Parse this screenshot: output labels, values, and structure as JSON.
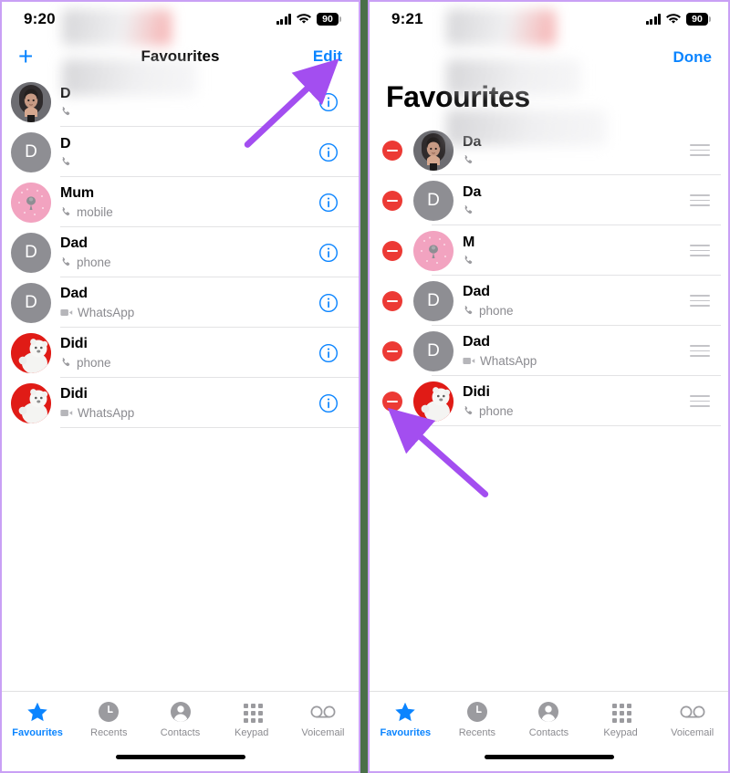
{
  "meta": {
    "accent_blue": "#0a84ff",
    "delete_red": "#ec3a35",
    "arrow_purple": "#a34ef0",
    "background_green": "#4a7049",
    "frame_purple": "#c9a0f5"
  },
  "left_phone": {
    "status": {
      "time": "9:20",
      "battery": "90",
      "signal_icon": "cellular-bars-icon",
      "wifi_icon": "wifi-icon",
      "battery_icon": "battery-icon"
    },
    "nav": {
      "add_icon": "plus-icon",
      "title": "Favourites",
      "edit_label": "Edit"
    },
    "rows": [
      {
        "name": "D",
        "redacted": true,
        "sub": "",
        "sub_icon": "phone-icon",
        "avatar": "photo",
        "avatar_letter": ""
      },
      {
        "name": "D",
        "redacted": true,
        "sub": "",
        "sub_icon": "phone-icon",
        "avatar": "initial",
        "avatar_letter": "D"
      },
      {
        "name": "Mum",
        "redacted": false,
        "sub": "mobile",
        "sub_icon": "phone-icon",
        "avatar": "mum",
        "avatar_letter": ""
      },
      {
        "name": "Dad",
        "redacted": false,
        "sub": "phone",
        "sub_icon": "phone-icon",
        "avatar": "initial",
        "avatar_letter": "D"
      },
      {
        "name": "Dad",
        "redacted": false,
        "sub": "WhatsApp",
        "sub_icon": "video-icon",
        "avatar": "initial",
        "avatar_letter": "D"
      },
      {
        "name": "Didi",
        "redacted": false,
        "sub": "phone",
        "sub_icon": "phone-icon",
        "avatar": "bear",
        "avatar_letter": ""
      },
      {
        "name": "Didi",
        "redacted": false,
        "sub": "WhatsApp",
        "sub_icon": "video-icon",
        "avatar": "bear",
        "avatar_letter": ""
      }
    ],
    "info_icon": "info-circle-icon",
    "tabs": [
      {
        "label": "Favourites",
        "icon": "star-icon",
        "active": true
      },
      {
        "label": "Recents",
        "icon": "clock-icon",
        "active": false
      },
      {
        "label": "Contacts",
        "icon": "person-icon",
        "active": false
      },
      {
        "label": "Keypad",
        "icon": "keypad-icon",
        "active": false
      },
      {
        "label": "Voicemail",
        "icon": "voicemail-icon",
        "active": false
      }
    ]
  },
  "right_phone": {
    "status": {
      "time": "9:21",
      "battery": "90",
      "signal_icon": "cellular-bars-icon",
      "wifi_icon": "wifi-icon",
      "battery_icon": "battery-icon"
    },
    "nav": {
      "done_label": "Done",
      "large_title": "Favourites"
    },
    "rows": [
      {
        "name": "Da",
        "redacted": true,
        "sub": "",
        "sub_icon": "phone-icon",
        "avatar": "photo",
        "avatar_letter": ""
      },
      {
        "name": "Da",
        "redacted": true,
        "sub": "",
        "sub_icon": "phone-icon",
        "avatar": "initial",
        "avatar_letter": "D"
      },
      {
        "name": "M",
        "redacted": true,
        "sub": "",
        "sub_icon": "phone-icon",
        "avatar": "mum",
        "avatar_letter": ""
      },
      {
        "name": "Dad",
        "redacted": false,
        "sub": "phone",
        "sub_icon": "phone-icon",
        "avatar": "initial",
        "avatar_letter": "D"
      },
      {
        "name": "Dad",
        "redacted": false,
        "sub": "WhatsApp",
        "sub_icon": "video-icon",
        "avatar": "initial",
        "avatar_letter": "D"
      },
      {
        "name": "Didi",
        "redacted": false,
        "sub": "phone",
        "sub_icon": "phone-icon",
        "avatar": "bear",
        "avatar_letter": ""
      }
    ],
    "delete_icon": "remove-minus-icon",
    "reorder_icon": "reorder-handle-icon",
    "tabs": [
      {
        "label": "Favourites",
        "icon": "star-icon",
        "active": true
      },
      {
        "label": "Recents",
        "icon": "clock-icon",
        "active": false
      },
      {
        "label": "Contacts",
        "icon": "person-icon",
        "active": false
      },
      {
        "label": "Keypad",
        "icon": "keypad-icon",
        "active": false
      },
      {
        "label": "Voicemail",
        "icon": "voicemail-icon",
        "active": false
      }
    ]
  },
  "annotations": [
    {
      "name": "arrow-pointing-to-edit",
      "target": "Edit"
    },
    {
      "name": "arrow-pointing-to-delete-button",
      "target": "remove-minus-icon"
    }
  ]
}
